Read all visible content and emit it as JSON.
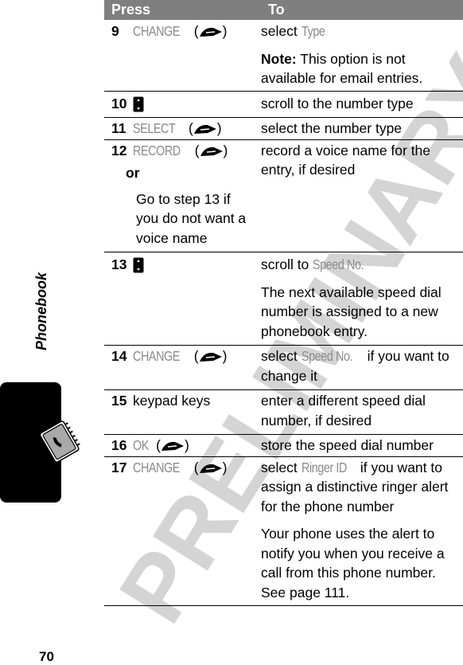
{
  "watermark": "PRELIMINARY",
  "section_label": "Phonebook",
  "page_number": "70",
  "table": {
    "headers": {
      "press": "Press",
      "to": "To"
    },
    "rows": [
      {
        "step": "9",
        "press_key": "CHANGE",
        "press_icon": "softkey-icon",
        "to": [
          {
            "text": "select ",
            "display": "Type",
            "after": ""
          }
        ],
        "note": {
          "label": "Note:",
          "text": " This option is not available for email entries."
        }
      },
      {
        "step": "10",
        "press_icon": "nav-key-icon",
        "to_text": "scroll to the number type"
      },
      {
        "step": "11",
        "press_key": "SELECT",
        "press_icon": "softkey-icon",
        "to_text": "select the number type"
      },
      {
        "step": "12",
        "press_key": "RECORD",
        "press_icon": "softkey-icon",
        "press_or": "or",
        "press_alt": "Go to step 13 if you do not want a voice name",
        "to_text": "record a voice name for the entry, if desired"
      },
      {
        "step": "13",
        "press_icon": "nav-key-icon",
        "to_prefix": "scroll to ",
        "to_display": "Speed No.",
        "to_extra": "The next available speed dial number is assigned to a new phonebook entry."
      },
      {
        "step": "14",
        "press_key": "CHANGE",
        "press_icon": "softkey-icon",
        "to_prefix": "select ",
        "to_display": "Speed No.",
        "to_suffix": " if you want to change it"
      },
      {
        "step": "15",
        "press_text": "keypad keys",
        "to_text": "enter a different speed dial number, if desired"
      },
      {
        "step": "16",
        "press_key": "OK",
        "press_icon": "softkey-icon",
        "to_text": "store the speed dial number"
      },
      {
        "step": "17",
        "press_key": "CHANGE",
        "press_icon": "softkey-icon",
        "to_prefix": "select ",
        "to_display": "Ringer ID",
        "to_suffix": " if you want to assign a distinctive ringer alert for the phone number",
        "to_extra": "Your phone uses the alert to notify you when you receive a call from this phone number. See page 111."
      }
    ]
  },
  "paren_open": "(",
  "paren_close": ")"
}
